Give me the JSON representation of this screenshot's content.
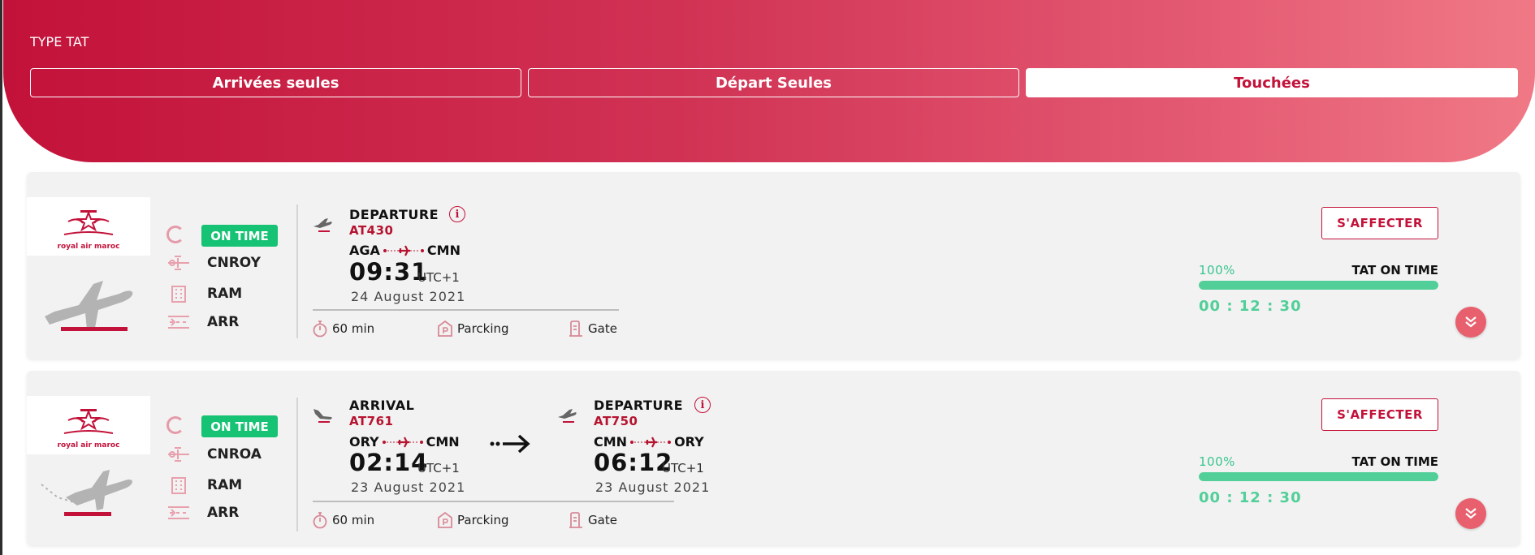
{
  "header": {
    "type_label": "TYPE TAT",
    "tabs": [
      {
        "label": "Arrivées seules",
        "active": false
      },
      {
        "label": "Départ Seules",
        "active": false
      },
      {
        "label": "Touchées",
        "active": true
      }
    ]
  },
  "cards": [
    {
      "logo_text": "royal air maroc",
      "plane_icon": "airplane-takeoff-icon",
      "status": "ON TIME",
      "registration": "CNROY",
      "company": "RAM",
      "category": "ARR",
      "legs": [
        {
          "type": "DEPARTURE",
          "flight": "AT430",
          "from": "AGA",
          "to": "CMN",
          "time": "09:31",
          "tz": "UTC+1",
          "date": "24 August 2021"
        }
      ],
      "footer": {
        "duration": "60 min",
        "parking": "Parcking",
        "gate": "Gate"
      },
      "action": "S'AFFECTER",
      "progress_label": "100%",
      "progress_value": 100,
      "tat_label": "TAT ON TIME",
      "timer": "00 : 12 : 30"
    },
    {
      "logo_text": "royal air maroc",
      "plane_icon": "airplane-landing-icon",
      "status": "ON TIME",
      "registration": "CNROA",
      "company": "RAM",
      "category": "ARR",
      "legs": [
        {
          "type": "ARRIVAL",
          "flight": "AT761",
          "from": "ORY",
          "to": "CMN",
          "time": "02:14",
          "tz": "UTC+1",
          "date": "23 August 2021"
        },
        {
          "type": "DEPARTURE",
          "flight": "AT750",
          "from": "CMN",
          "to": "ORY",
          "time": "06:12",
          "tz": "UTC+1",
          "date": "23 August 2021"
        }
      ],
      "footer": {
        "duration": "60 min",
        "parking": "Parcking",
        "gate": "Gate"
      },
      "action": "S'AFFECTER",
      "progress_label": "100%",
      "progress_value": 100,
      "tat_label": "TAT ON TIME",
      "timer": "00 : 12 : 30"
    }
  ],
  "colors": {
    "brand": "#c3123a",
    "status_green": "#16c274",
    "progress_green": "#52cf98"
  }
}
